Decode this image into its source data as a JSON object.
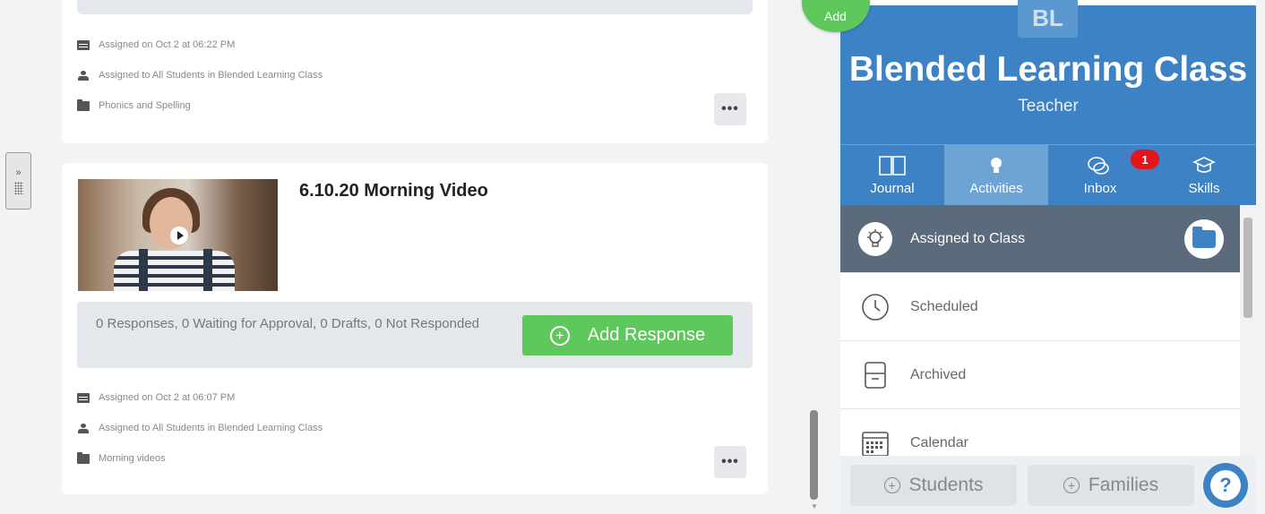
{
  "top_post": {
    "assigned_on": "Assigned on Oct 2 at 06:22 PM",
    "assigned_to": "Assigned to All Students in Blended Learning Class",
    "folder": "Phonics and Spelling",
    "more_label": "•••"
  },
  "video_post": {
    "title": "6.10.20 Morning Video",
    "responses_text": "0 Responses, 0 Waiting for Approval, 0 Drafts, 0 Not Responded",
    "add_response_label": "Add Response",
    "assigned_on": "Assigned on Oct 2 at 06:07 PM",
    "assigned_to": "Assigned to All Students in Blended Learning Class",
    "folder": "Morning videos",
    "more_label": "•••"
  },
  "collapse_tab_label": "»",
  "add_fab_label": "Add",
  "class_panel": {
    "avatar_initials": "BL",
    "class_name": "Blended Learning Class",
    "role": "Teacher",
    "tabs": [
      {
        "label": "Journal",
        "icon": "book-icon"
      },
      {
        "label": "Activities",
        "icon": "lightbulb-icon",
        "active": true
      },
      {
        "label": "Inbox",
        "icon": "chat-icon",
        "badge": "1"
      },
      {
        "label": "Skills",
        "icon": "graduation-cap-icon"
      }
    ],
    "list_items": [
      {
        "label": "Assigned to Class",
        "icon": "lightbulb-icon",
        "selected": true
      },
      {
        "label": "Scheduled",
        "icon": "clock-icon"
      },
      {
        "label": "Archived",
        "icon": "archive-icon"
      },
      {
        "label": "Calendar",
        "icon": "calendar-icon"
      }
    ],
    "bottom": {
      "students_label": "Students",
      "families_label": "Families",
      "help_label": "?"
    }
  },
  "colors": {
    "brand_blue": "#3d82c4",
    "green": "#5fc85c",
    "selected_row": "#5b6b7c",
    "badge_red": "#e3151a"
  }
}
